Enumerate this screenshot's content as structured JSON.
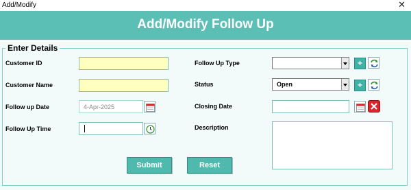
{
  "window": {
    "title": "Add/Modify"
  },
  "header": {
    "title": "Add/Modify Follow Up"
  },
  "group": {
    "legend": "Enter Details"
  },
  "fields": {
    "customer_id": {
      "label": "Customer ID",
      "value": ""
    },
    "customer_name": {
      "label": "Customer Name",
      "value": ""
    },
    "follow_up_date": {
      "label": "Follow up Date",
      "value": "4-Apr-2025"
    },
    "follow_up_time": {
      "label": "Follow Up Time",
      "value": ""
    },
    "follow_up_type": {
      "label": "Follow Up Type",
      "value": ""
    },
    "status": {
      "label": "Status",
      "value": "Open"
    },
    "closing_date": {
      "label": "Closing Date",
      "value": ""
    },
    "description": {
      "label": "Description",
      "value": ""
    }
  },
  "buttons": {
    "submit": "Submit",
    "reset": "Reset"
  },
  "icons": {
    "close": "close-icon",
    "calendar": "calendar-icon",
    "clock": "clock-icon",
    "plus": "plus-icon",
    "refresh": "refresh-icon",
    "clear": "clear-icon"
  },
  "colors": {
    "accent": "#5bbfb5",
    "button": "#4fb9ad",
    "input_highlight": "#ffffc0",
    "clear_red": "#d9262c"
  }
}
